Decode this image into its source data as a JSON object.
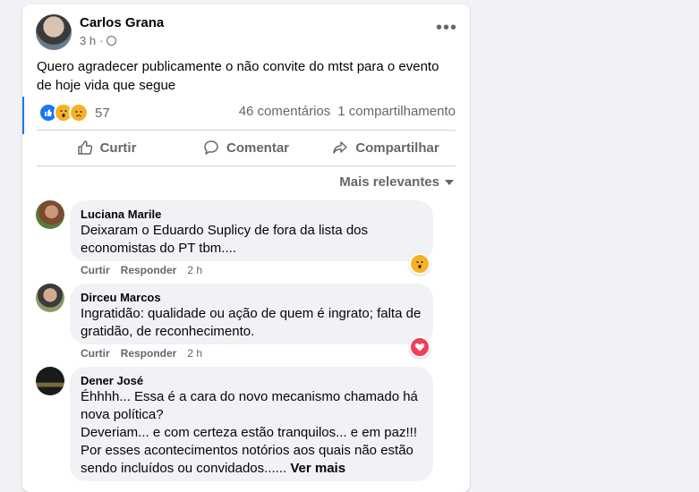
{
  "post": {
    "author": "Carlos Grana",
    "time": "3 h",
    "privacy_icon": "globe-icon",
    "more_label": "•••",
    "text": "Quero agradecer publicamente o não convite do mtst para o evento de hoje  vida que segue",
    "reaction_count": "57",
    "comments_count": "46 comentários",
    "shares_count": "1 compartilhamento"
  },
  "actions": {
    "like": "Curtir",
    "comment": "Comentar",
    "share": "Compartilhar"
  },
  "sort_label": "Mais relevantes",
  "colors": {
    "accent": "#1877f2",
    "muted": "#65676b",
    "bubble": "#f0f2f5",
    "love": "#f33e58",
    "wow": "#f7b125"
  },
  "comments": [
    {
      "name": "Luciana Marile",
      "text": "Deixaram o Eduardo Suplicy de fora da lista dos economistas do PT tbm....",
      "like": "Curtir",
      "reply": "Responder",
      "time": "2 h",
      "reaction": "wow-icon"
    },
    {
      "name": "Dirceu Marcos",
      "text": "Ingratidão: qualidade ou ação de quem é ingrato; falta de gratidão, de reconhecimento.",
      "like": "Curtir",
      "reply": "Responder",
      "time": "2 h",
      "reaction": "love-icon"
    },
    {
      "name": "Dener José",
      "text": "Éhhhh... Essa é a cara do novo mecanismo chamado há nova política?\nDeveriam... e com certeza estão tranquilos... e em paz!!!\nPor esses acontecimentos notórios aos quais não estão sendo incluídos ou convidados......",
      "see_more": "Ver mais"
    }
  ]
}
